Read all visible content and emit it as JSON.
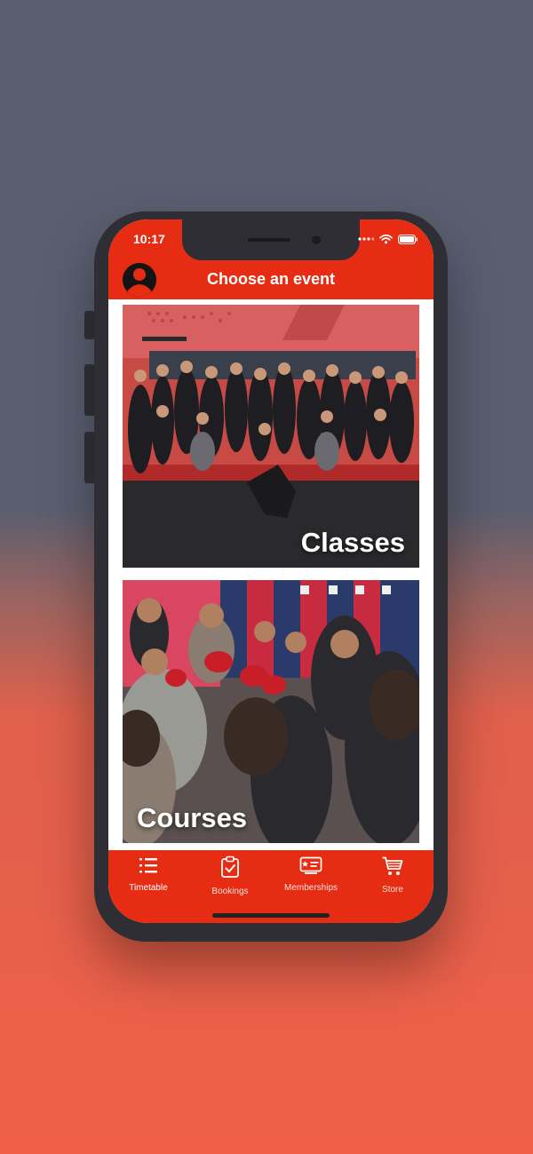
{
  "status_bar": {
    "time": "10:17"
  },
  "header": {
    "title": "Choose an event"
  },
  "events": [
    {
      "label": "Classes"
    },
    {
      "label": "Courses"
    }
  ],
  "tabs": [
    {
      "label": "Timetable",
      "icon": "list-icon"
    },
    {
      "label": "Bookings",
      "icon": "clipboard-check-icon"
    },
    {
      "label": "Memberships",
      "icon": "membership-card-icon"
    },
    {
      "label": "Store",
      "icon": "cart-icon"
    }
  ],
  "colors": {
    "brand_red": "#e62c12",
    "background_top": "#5a5e70",
    "background_bottom": "#f06048"
  }
}
